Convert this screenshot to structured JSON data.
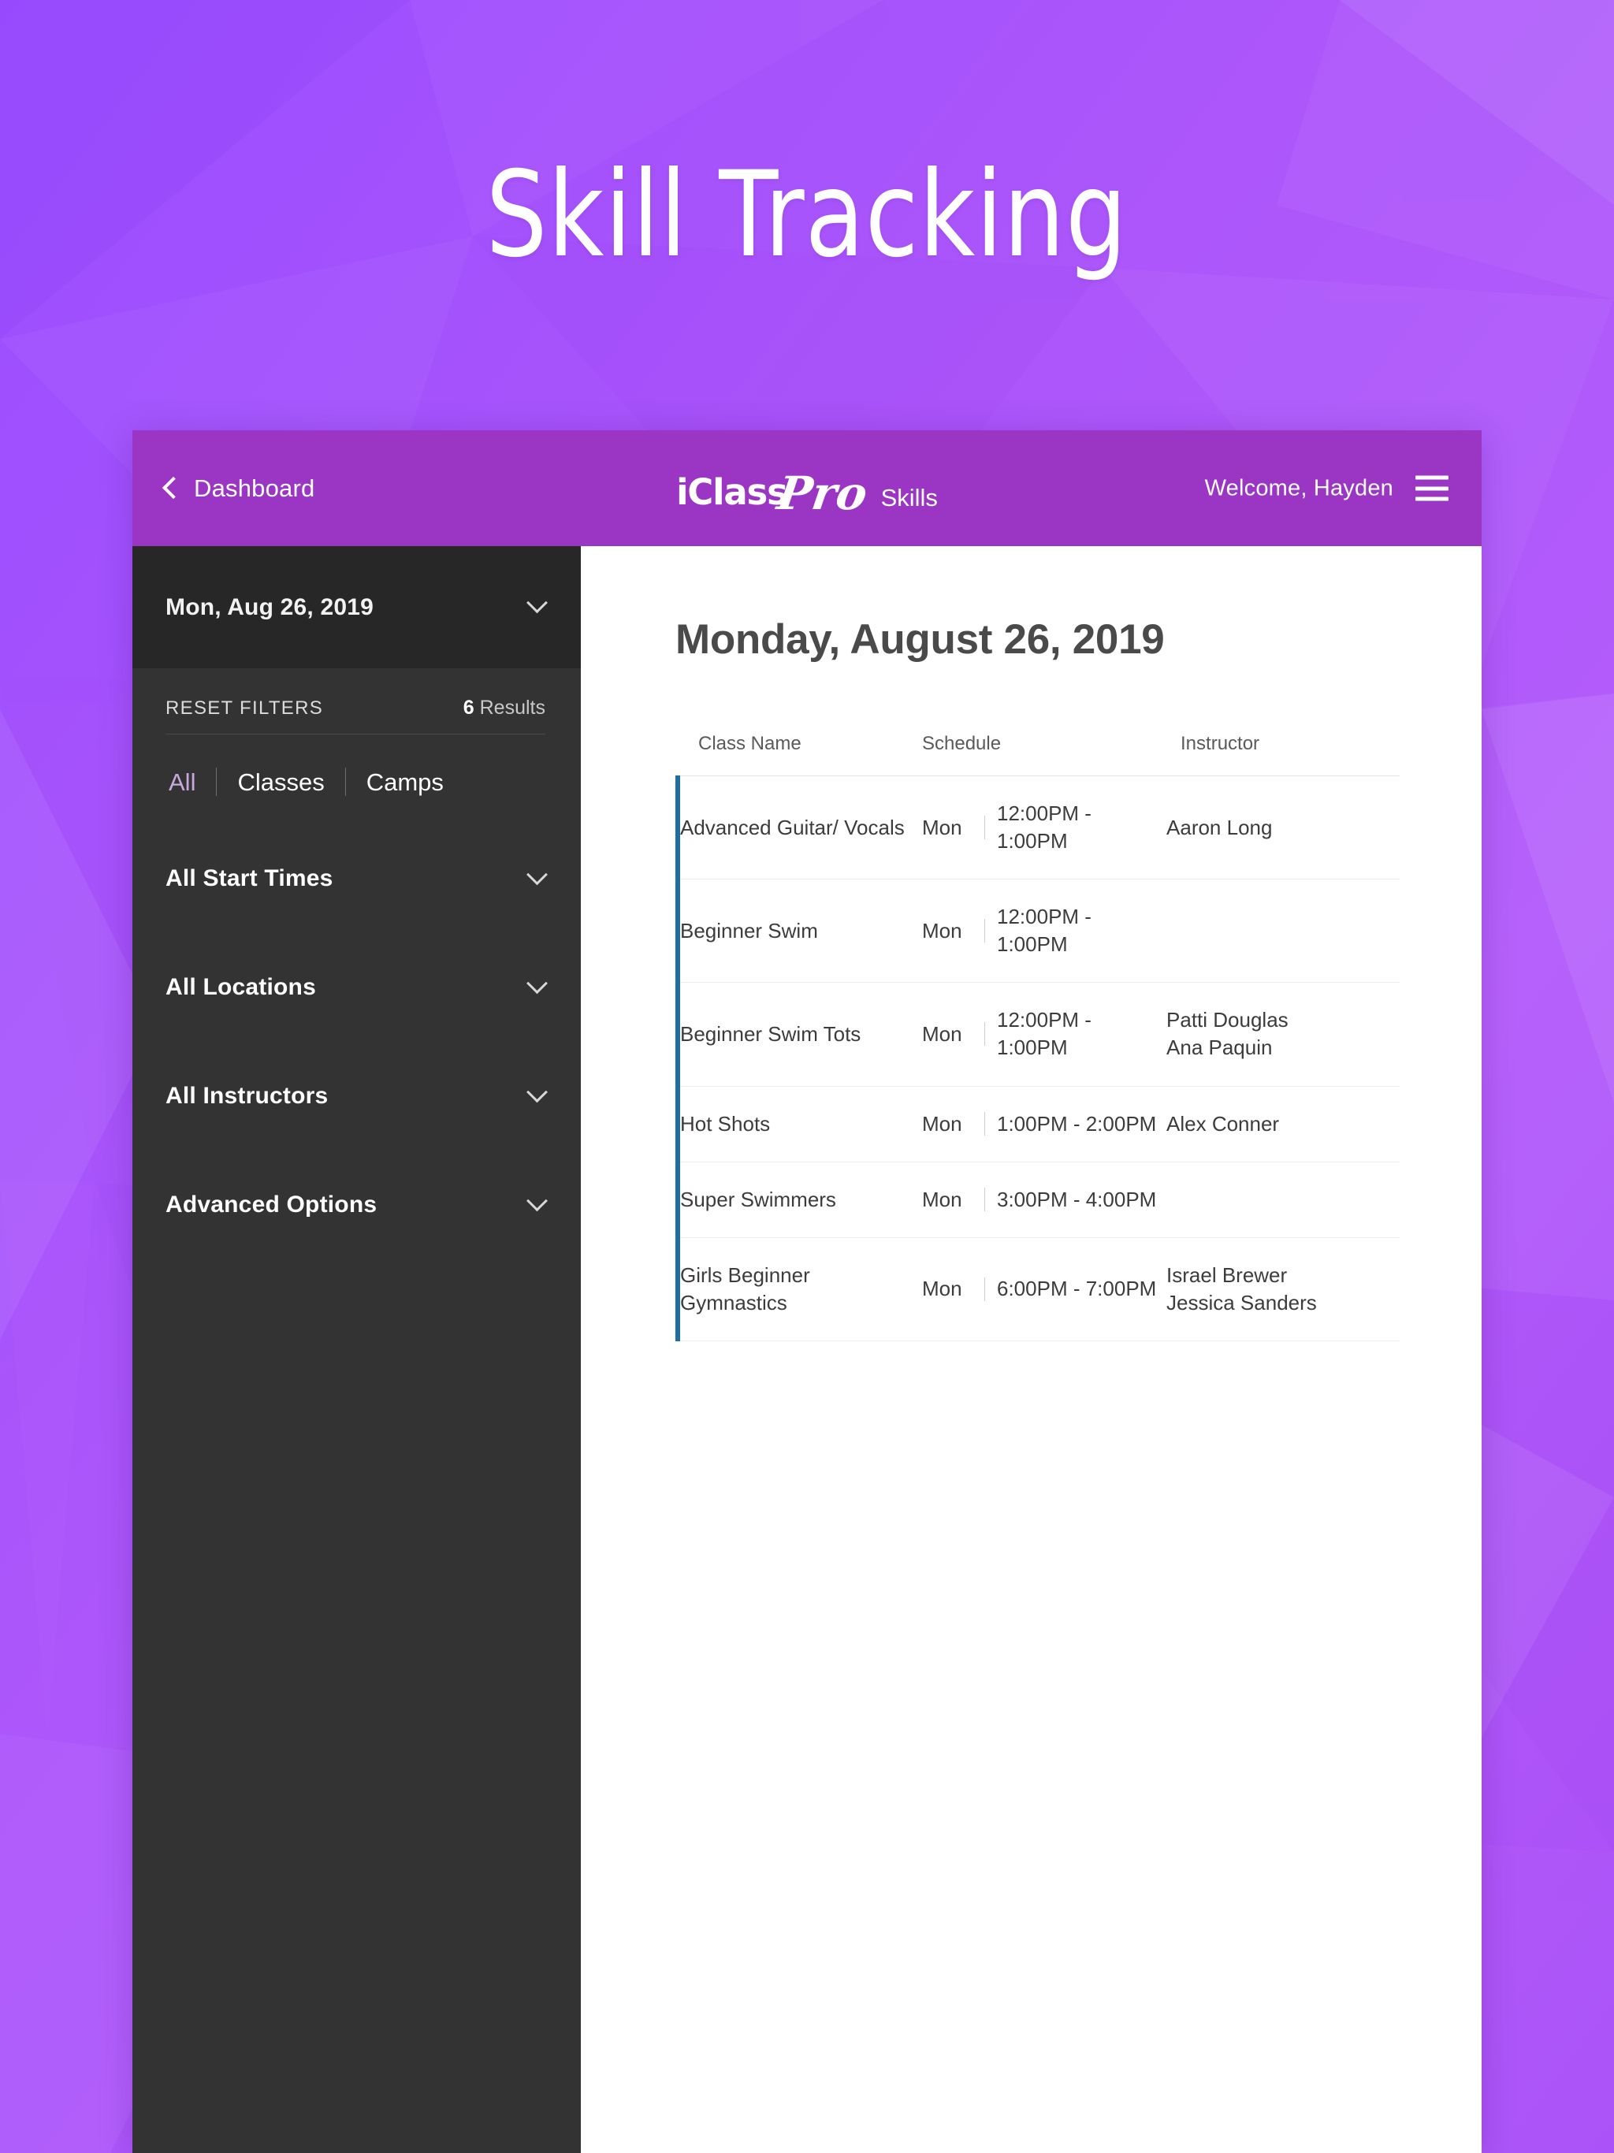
{
  "hero": {
    "title": "Skill Tracking"
  },
  "colors": {
    "background_purple": "#a855f7",
    "topbar_purple": "#9B35C4",
    "sidebar_dark": "#333333",
    "date_selector_dark": "#272727",
    "row_accent_blue": "#1C6EA4",
    "active_tab_lavender": "#c9a8e0"
  },
  "topbar": {
    "back_icon": "chevron-left-icon",
    "back_label": "Dashboard",
    "logo_primary": "iClass",
    "logo_script": "Pro",
    "app_name": "Skills",
    "welcome": "Welcome, Hayden",
    "menu_icon": "hamburger-menu-icon"
  },
  "sidebar": {
    "date_selector": {
      "value": "Mon, Aug 26, 2019",
      "chevron_icon": "chevron-down-icon"
    },
    "reset_filters": "RESET FILTERS",
    "results_count_number": "6",
    "results_count_label": "Results",
    "type_tabs": [
      {
        "label": "All",
        "active": true
      },
      {
        "label": "Classes",
        "active": false
      },
      {
        "label": "Camps",
        "active": false
      }
    ],
    "filter_groups": [
      {
        "label": "All Start Times",
        "chevron_icon": "chevron-down-icon"
      },
      {
        "label": "All Locations",
        "chevron_icon": "chevron-down-icon"
      },
      {
        "label": "All Instructors",
        "chevron_icon": "chevron-down-icon"
      },
      {
        "label": "Advanced Options",
        "chevron_icon": "chevron-down-icon"
      }
    ]
  },
  "content": {
    "title": "Monday, August 26, 2019",
    "table": {
      "columns": [
        "Class Name",
        "Schedule",
        "Instructor"
      ],
      "rows": [
        {
          "class_name": "Advanced Guitar/ Vocals",
          "day": "Mon",
          "time": "12:00PM - 1:00PM",
          "instructors": [
            "Aaron Long"
          ]
        },
        {
          "class_name": "Beginner Swim",
          "day": "Mon",
          "time": "12:00PM - 1:00PM",
          "instructors": []
        },
        {
          "class_name": "Beginner Swim Tots",
          "day": "Mon",
          "time": "12:00PM - 1:00PM",
          "instructors": [
            "Patti Douglas",
            "Ana Paquin"
          ]
        },
        {
          "class_name": "Hot Shots",
          "day": "Mon",
          "time": "1:00PM - 2:00PM",
          "instructors": [
            "Alex Conner"
          ]
        },
        {
          "class_name": "Super Swimmers",
          "day": "Mon",
          "time": "3:00PM - 4:00PM",
          "instructors": []
        },
        {
          "class_name": "Girls Beginner Gymnastics",
          "day": "Mon",
          "time": "6:00PM - 7:00PM",
          "instructors": [
            "Israel Brewer",
            "Jessica Sanders"
          ]
        }
      ]
    }
  }
}
